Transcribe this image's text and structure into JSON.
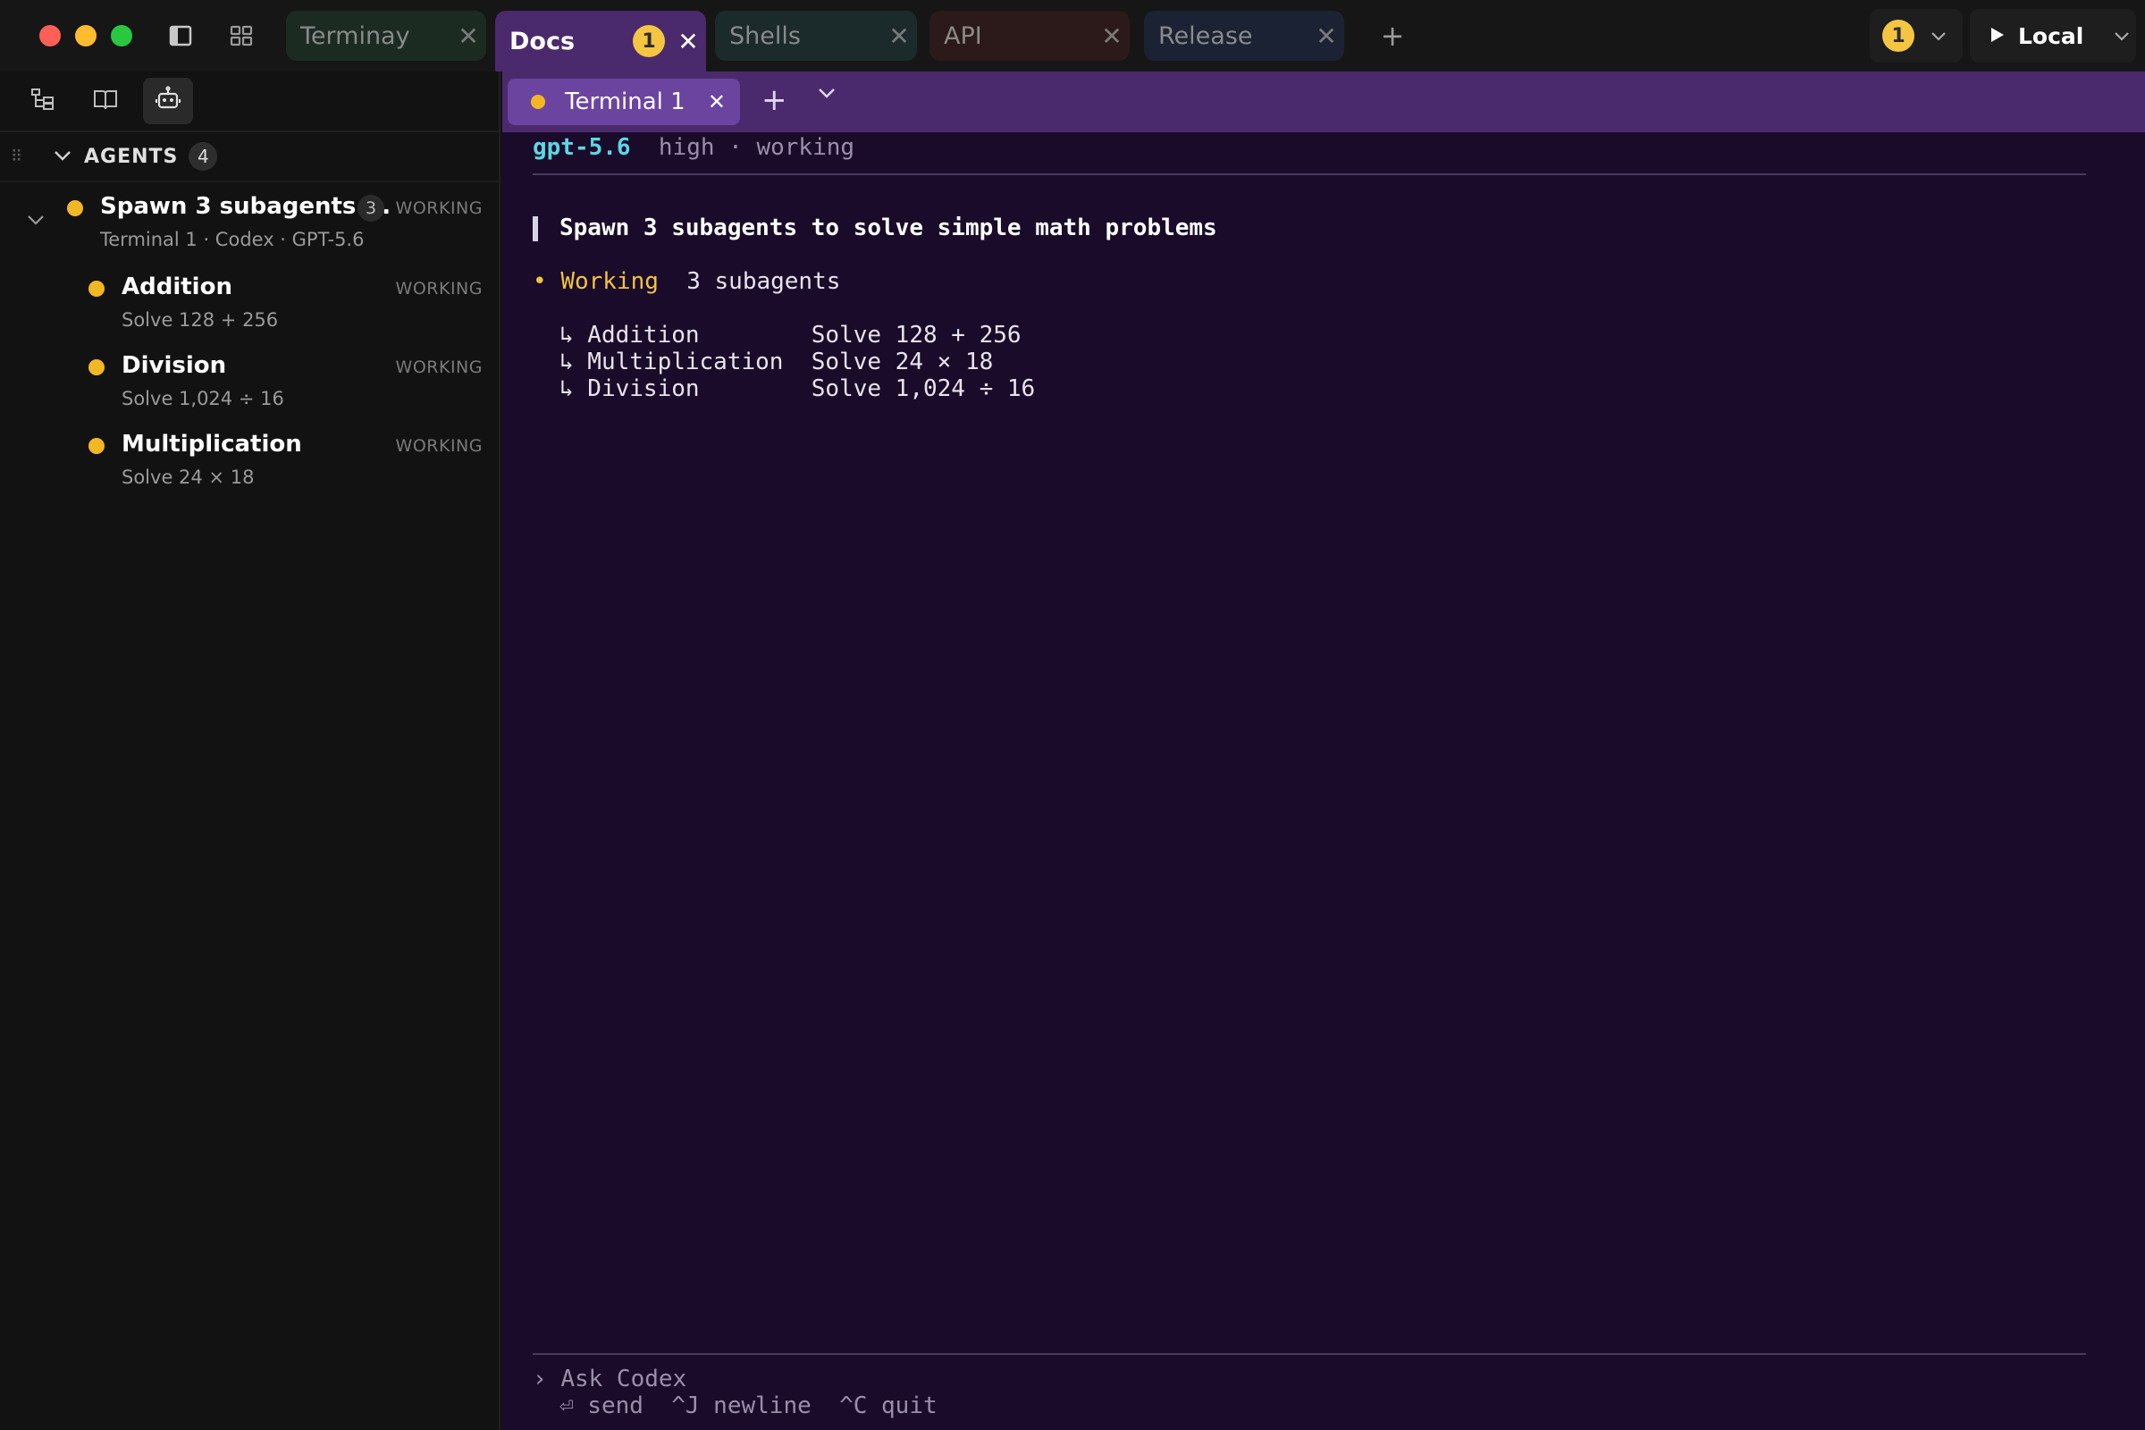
{
  "titlebar": {
    "tabs": [
      {
        "label": "Terminay",
        "close": "✕"
      },
      {
        "label": "Docs",
        "badge": "1",
        "close": "✕"
      },
      {
        "label": "Shells",
        "close": "✕"
      },
      {
        "label": "API",
        "close": "✕"
      },
      {
        "label": "Release",
        "close": "✕"
      }
    ],
    "new_tab": "+",
    "notification_count": "1",
    "run_target": "Local"
  },
  "sidebar": {
    "section_title": "AGENTS",
    "section_count": "4",
    "agents": [
      {
        "name": "Spawn 3 subagents ...",
        "subtitle": "Terminal 1 · Codex · GPT-5.6",
        "count": "3",
        "status": "WORKING"
      },
      {
        "name": "Addition",
        "subtitle": "Solve 128 + 256",
        "status": "WORKING"
      },
      {
        "name": "Division",
        "subtitle": "Solve 1,024 ÷ 16",
        "status": "WORKING"
      },
      {
        "name": "Multiplication",
        "subtitle": "Solve 24 × 18",
        "status": "WORKING"
      }
    ]
  },
  "tabstrip": {
    "active_tab": "Terminal 1",
    "close": "✕",
    "add": "+"
  },
  "terminal": {
    "model": "gpt-5.6",
    "model_meta": "high · working",
    "prompt": "Spawn 3 subagents to solve simple math problems",
    "status_bullet": "•",
    "status_word": "Working",
    "status_detail": "3 subagents",
    "subagents": [
      "↳ Addition        Solve 128 + 256",
      "↳ Multiplication  Solve 24 × 18",
      "↳ Division        Solve 1,024 ÷ 16"
    ],
    "input_caret": "›",
    "input_placeholder": "Ask Codex",
    "hints": "⏎ send  ^J newline  ^C quit"
  },
  "colors": {
    "accent_purple": "#4a2a6c",
    "terminal_bg": "#1a0b2a",
    "working_yellow": "#f2b824",
    "model_cyan": "#5ad8e6"
  }
}
